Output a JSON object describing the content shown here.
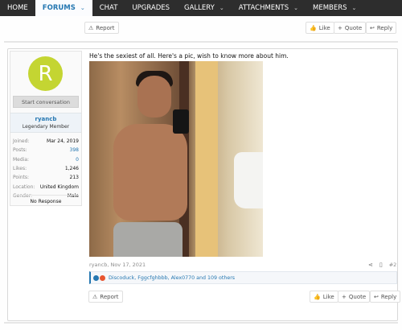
{
  "nav": {
    "items": [
      {
        "label": "HOME",
        "caret": false,
        "active": false
      },
      {
        "label": "FORUMS",
        "caret": true,
        "active": true
      },
      {
        "label": "CHAT",
        "caret": false,
        "active": false
      },
      {
        "label": "UPGRADES",
        "caret": false,
        "active": false
      },
      {
        "label": "GALLERY",
        "caret": true,
        "active": false
      },
      {
        "label": "ATTACHMENTS",
        "caret": true,
        "active": false
      },
      {
        "label": "MEMBERS",
        "caret": true,
        "active": false
      }
    ],
    "caret_glyph": "⌄"
  },
  "prev_post": {
    "report_label": "Report",
    "like_label": "Like",
    "quote_label": "Quote",
    "reply_label": "Reply"
  },
  "post": {
    "avatar_letter": "R",
    "avatar_color": "#c4d532",
    "start_conversation": "Start conversation",
    "username": "ryancb",
    "user_title": "Legendary Member",
    "stats": [
      {
        "key": "Joined:",
        "value": "Mar 24, 2019",
        "link": false
      },
      {
        "key": "Posts:",
        "value": "398",
        "link": true
      },
      {
        "key": "Media:",
        "value": "0",
        "link": true
      },
      {
        "key": "Likes:",
        "value": "1,246",
        "link": false
      },
      {
        "key": "Points:",
        "value": "213",
        "link": false
      },
      {
        "key": "Location:",
        "value": "United Kingdom",
        "link": false
      },
      {
        "key": "Gender:",
        "value": "Male",
        "link": false
      }
    ],
    "no_response": "No Response",
    "text": "He's the sexiest of all. Here's a pic, wish to know more about him.",
    "meta": "ryancb, Nov 17, 2021",
    "post_number": "#2",
    "reactions": "Discoduck, Fggcfghbbb, Alex0770 and 109 others",
    "report_label": "Report",
    "like_label": "Like",
    "quote_label": "Quote",
    "reply_label": "Reply"
  },
  "icons": {
    "report": "warning-icon",
    "like": "thumbs-up-icon",
    "quote": "plus-icon",
    "reply": "reply-icon",
    "share": "share-icon",
    "bookmark": "bookmark-icon"
  },
  "colors": {
    "nav_bg": "#2d2d2d",
    "link": "#2577b1",
    "accent": "#2577b1"
  }
}
